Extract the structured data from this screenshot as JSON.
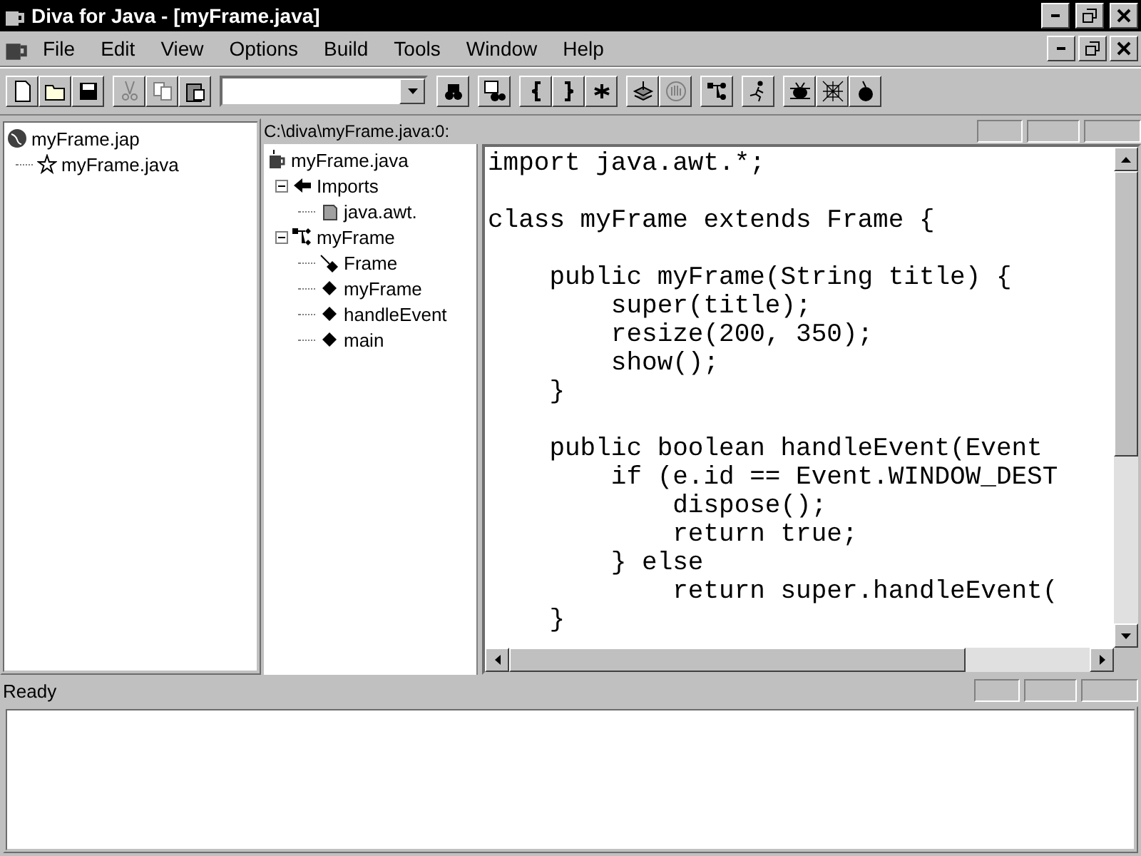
{
  "window": {
    "title": "Diva for Java - [myFrame.java]"
  },
  "menu": [
    "File",
    "Edit",
    "View",
    "Options",
    "Build",
    "Tools",
    "Window",
    "Help"
  ],
  "toolbar": [
    {
      "group": [
        {
          "kind": "new",
          "disabled": false
        },
        {
          "kind": "open",
          "disabled": false
        },
        {
          "kind": "save",
          "disabled": false
        }
      ]
    },
    {
      "group": [
        {
          "kind": "cut",
          "disabled": true
        },
        {
          "kind": "copy",
          "disabled": true
        },
        {
          "kind": "paste",
          "disabled": false
        }
      ]
    },
    {
      "group": [
        {
          "kind": "combo",
          "disabled": false
        }
      ]
    },
    {
      "group": [
        {
          "kind": "find",
          "disabled": false
        }
      ]
    },
    {
      "group": [
        {
          "kind": "replace",
          "disabled": false
        }
      ]
    },
    {
      "group": [
        {
          "kind": "brace-open",
          "disabled": false
        },
        {
          "kind": "brace-close",
          "disabled": false
        },
        {
          "kind": "asterisk",
          "disabled": false
        }
      ]
    },
    {
      "group": [
        {
          "kind": "stack",
          "disabled": false
        },
        {
          "kind": "hand",
          "disabled": true
        }
      ]
    },
    {
      "group": [
        {
          "kind": "hierarchy",
          "disabled": false
        }
      ]
    },
    {
      "group": [
        {
          "kind": "runner",
          "disabled": false
        }
      ]
    },
    {
      "group": [
        {
          "kind": "bug",
          "disabled": false
        },
        {
          "kind": "web",
          "disabled": false
        },
        {
          "kind": "bomb",
          "disabled": false
        }
      ]
    }
  ],
  "project_tree": [
    {
      "label": "myFrame.jap",
      "kind": "globe",
      "children": [
        {
          "label": "myFrame.java",
          "kind": "star"
        }
      ]
    }
  ],
  "path_header": "C:\\diva\\myFrame.java:0:",
  "class_tree": [
    {
      "label": "myFrame.java",
      "kind": "file",
      "children": [
        {
          "label": "Imports",
          "kind": "import",
          "expanded": true,
          "children": [
            {
              "label": "java.awt.",
              "kind": "package"
            }
          ]
        },
        {
          "label": "myFrame",
          "kind": "class",
          "expanded": true,
          "children": [
            {
              "label": "Frame",
              "kind": "super"
            },
            {
              "label": "myFrame",
              "kind": "method"
            },
            {
              "label": "handleEvent",
              "kind": "method"
            },
            {
              "label": "main",
              "kind": "method"
            }
          ]
        }
      ]
    }
  ],
  "code_blocks": [
    [
      "import java.awt.*;"
    ],
    [
      "class myFrame extends Frame {"
    ],
    [
      "    public myFrame(String title) {",
      "        super(title);",
      "        resize(200, 350);",
      "        show();",
      "    }"
    ],
    [
      "    public boolean handleEvent(Event",
      "        if (e.id == Event.WINDOW_DEST",
      "            dispose();",
      "            return true;",
      "        } else",
      "            return super.handleEvent(",
      "    }"
    ]
  ],
  "status_bar": {
    "text": "Ready"
  }
}
